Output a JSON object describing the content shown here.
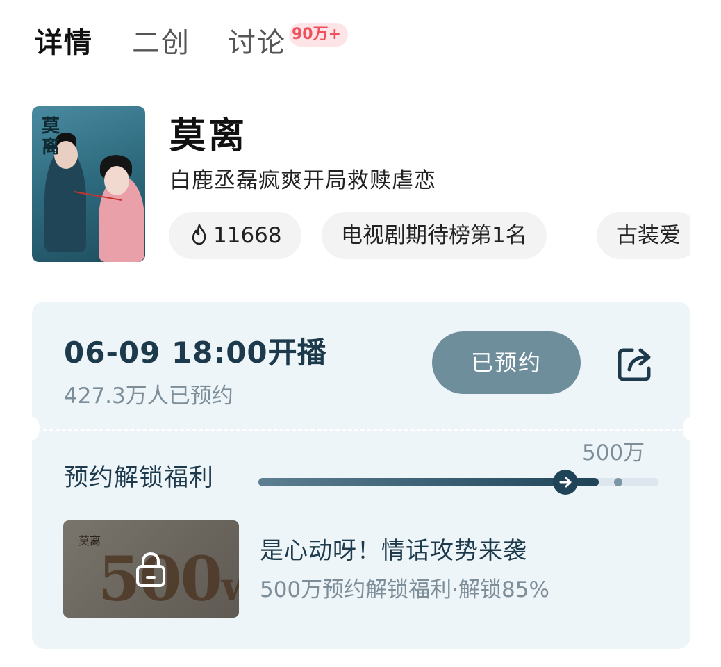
{
  "tabs": [
    {
      "label": "详情"
    },
    {
      "label": "二创"
    },
    {
      "label": "讨论",
      "badge": "90万+"
    }
  ],
  "drama": {
    "poster_text": "莫离",
    "title": "莫离",
    "subtitle": "白鹿丞磊疯爽开局救赎虐恋",
    "chips": [
      {
        "icon": "flame-icon",
        "text": "11668"
      },
      {
        "text": "电视剧期待榜第1名"
      },
      {
        "text": "古装爱"
      }
    ]
  },
  "release": {
    "datetime": "06-09 18:00",
    "suffix": "开播",
    "reserved_count": "427.3万人已预约",
    "reserve_button": "已预约"
  },
  "benefit": {
    "label": "预约解锁福利",
    "goal_label": "500万",
    "progress": 0.85,
    "thumb_text_big": "500",
    "thumb_text_unit": "w",
    "thumb_text_small": "莫离",
    "title": "是心动呀！情话攻势来袭",
    "description": "500万预约解锁福利·解锁85%"
  },
  "colors": {
    "card_bg": "#eef5f9",
    "primary_dark": "#1d3a4c",
    "button": "#6f8e9c",
    "badge_text": "#f0505c",
    "badge_bg": "#fde5e7",
    "muted": "#7e8e99"
  }
}
